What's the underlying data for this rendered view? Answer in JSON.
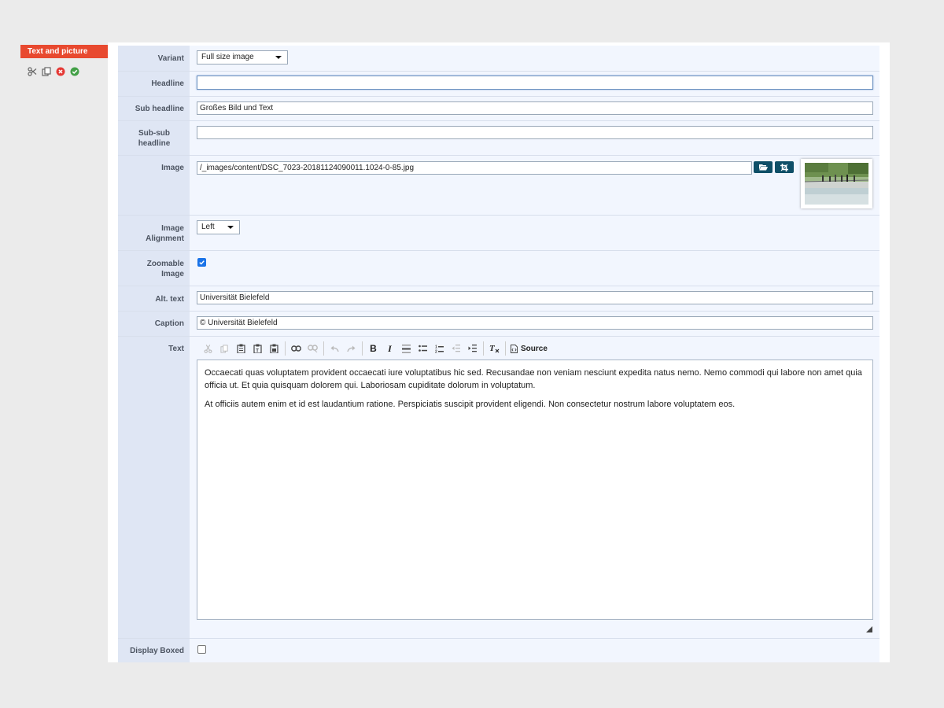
{
  "element": {
    "tag_label": "Text and picture",
    "tools": [
      {
        "icon": "scissors-icon"
      },
      {
        "icon": "copy-icon"
      },
      {
        "icon": "delete-circle-icon",
        "color": "#e53935"
      },
      {
        "icon": "confirm-circle-icon",
        "color": "#43a047"
      }
    ]
  },
  "form": {
    "variant": {
      "label": "Variant",
      "value": "Full size image"
    },
    "headline": {
      "label": "Headline",
      "value": ""
    },
    "sub_headline": {
      "label": "Sub headline",
      "value": "Großes Bild und Text"
    },
    "sub_sub_headline": {
      "label": "Sub-sub headline",
      "value": ""
    },
    "image": {
      "label": "Image",
      "value": "/_images/content/DSC_7023-20181124090011.1024-0-85.jpg",
      "browse_icon": "folder-open-icon",
      "crop_icon": "crop-icon"
    },
    "image_alignment": {
      "label": "Image Alignment",
      "value": "Left"
    },
    "zoomable_image": {
      "label": "Zoomable Image",
      "checked": true
    },
    "alt_text": {
      "label": "Alt. text",
      "value": "Universität Bielefeld"
    },
    "caption": {
      "label": "Caption",
      "value": "© Universität Bielefeld"
    },
    "text": {
      "label": "Text",
      "toolbar": {
        "source_label": "Source",
        "buttons": [
          "cut-icon",
          "copy-icon",
          "paste-icon",
          "paste-text-icon",
          "paste-word-icon",
          "link-icon",
          "unlink-icon",
          "undo-icon",
          "redo-icon",
          "bold-icon",
          "italic-icon",
          "horizontal-rule-icon",
          "bulleted-list-icon",
          "numbered-list-icon",
          "outdent-icon",
          "indent-icon",
          "remove-format-icon",
          "source-icon"
        ]
      },
      "paragraphs": [
        "Occaecati quas voluptatem provident occaecati iure voluptatibus hic sed. Recusandae non veniam nesciunt expedita natus nemo. Nemo commodi qui labore non amet quia officia ut. Et quia quisquam dolorem qui. Laboriosam cupiditate dolorum in voluptatum.",
        "At officiis autem enim et id est laudantium ratione. Perspiciatis suscipit provident eligendi. Non consectetur nostrum labore voluptatem eos."
      ]
    },
    "display_boxed": {
      "label": "Display Boxed",
      "checked": false
    }
  }
}
